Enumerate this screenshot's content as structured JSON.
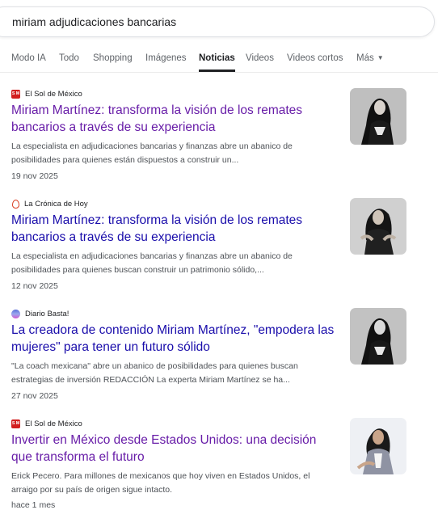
{
  "search": {
    "query": "miriam adjudicaciones bancarias"
  },
  "tabs": [
    {
      "label": "Modo IA"
    },
    {
      "label": "Todo"
    },
    {
      "label": "Shopping"
    },
    {
      "label": "Imágenes"
    },
    {
      "label": "Noticias",
      "active": true
    },
    {
      "label": "Videos"
    },
    {
      "label": "Videos cortos"
    },
    {
      "label": "Más"
    }
  ],
  "articles": [
    {
      "source": "El Sol de México",
      "favicon_text": "S M",
      "headline": "Miriam Martínez: transforma la visión de los remates bancarios a través de su experiencia",
      "snippet": "La especialista en adjudicaciones bancarias y finanzas abre un abanico de posibilidades para quienes están dispuestos a construir un...",
      "date": "19 nov 2025"
    },
    {
      "source": "La Crónica de Hoy",
      "headline": "Miriam Martínez: transforma la visión de los remates bancarios a través de su experiencia",
      "snippet": "La especialista en adjudicaciones bancarias y finanzas abre un abanico de posibilidades para quienes buscan construir un patrimonio sólido,...",
      "date": "12 nov 2025"
    },
    {
      "source": "Diario Basta!",
      "headline": "La creadora de contenido Miriam Martínez, \"empodera las mujeres\" para tener un futuro sólido",
      "snippet": "\"La coach mexicana\" abre un abanico de posibilidades para quienes buscan estrategias de inversión REDACCIÓN La experta Miriam Martínez se ha...",
      "date": "27 nov 2025"
    },
    {
      "source": "El Sol de México",
      "favicon_text": "S M",
      "headline": "Invertir en México desde Estados Unidos: una decisión que transforma el futuro",
      "snippet": "Erick Pecero. Para millones de mexicanos que hoy viven en Estados Unidos, el arraigo por su país de origen sigue intacto.",
      "date": "hace 1 mes"
    }
  ],
  "colors": {
    "link_visited": "#681da8",
    "link": "#1a0dab",
    "snippet": "#4d5156",
    "sol_red": "#d21e1e"
  }
}
